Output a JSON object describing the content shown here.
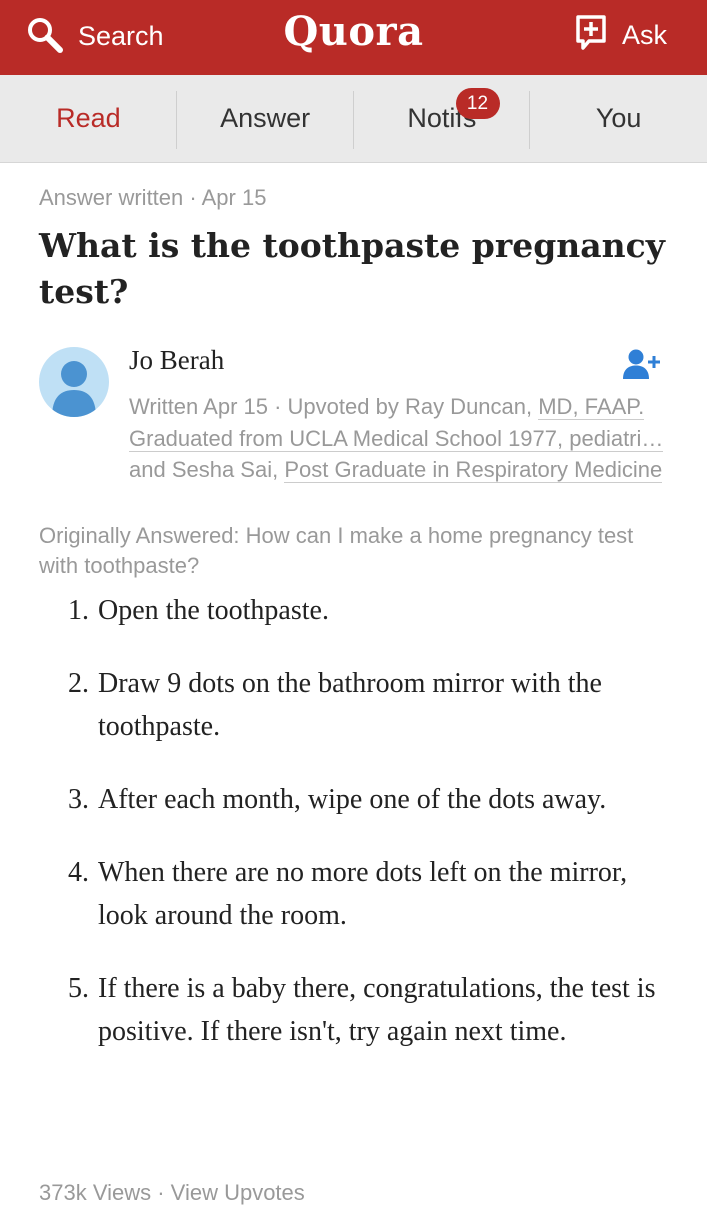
{
  "header": {
    "search_label": "Search",
    "logo": "Quora",
    "ask_label": "Ask",
    "brand_color": "#b92b27"
  },
  "nav": {
    "tabs": [
      {
        "label": "Read",
        "active": true
      },
      {
        "label": "Answer",
        "active": false
      },
      {
        "label": "Notifs",
        "active": false,
        "badge": "12"
      },
      {
        "label": "You",
        "active": false
      }
    ]
  },
  "answer": {
    "meta": "Answer written · Apr 15",
    "question": "What is the toothpaste pregnancy test?",
    "author": {
      "name": "Jo Berah",
      "written": "Written Apr 15 · Upvoted by Ray Duncan, ",
      "upvoter1_credential": "MD, FAAP. Graduated from UCLA Medical School 1977, pediatri…",
      "upvoter2_prefix": " and Sesha Sai, ",
      "upvoter2_credential": "Post Graduate in Respiratory Medicine"
    },
    "originally_answered": "Originally Answered: How can I make a home pregnancy test with toothpaste?",
    "steps": [
      {
        "num": "1.",
        "text": "Open the toothpaste."
      },
      {
        "num": "2.",
        "text": "Draw 9 dots on the bathroom mirror with the toothpaste."
      },
      {
        "num": "3.",
        "text": "After each month, wipe one of the dots away."
      },
      {
        "num": "4.",
        "text": "When there are no more dots left on the mirror, look around the room."
      },
      {
        "num": "5.",
        "text": "If there is a baby there, congratulations, the test is positive. If there isn't, try again next time."
      }
    ],
    "views": "373k Views",
    "separator": " · ",
    "view_upvotes": "View Upvotes"
  },
  "icons": {
    "search": "search-icon",
    "ask": "add-question-icon",
    "avatar": "default-avatar",
    "follow": "follow-user-icon"
  }
}
